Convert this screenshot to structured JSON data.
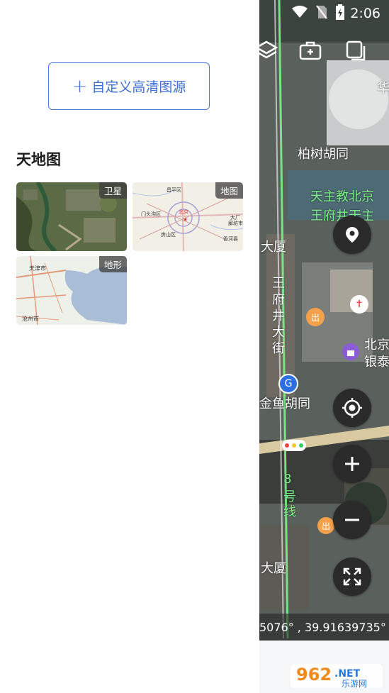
{
  "drawer": {
    "custom_source_button": {
      "icon": "plus-icon",
      "label": "自定义高清图源"
    },
    "section_title": "天地图",
    "tiles": [
      {
        "name": "satellite",
        "badge": "卫星"
      },
      {
        "name": "map",
        "badge": "地图",
        "labels": [
          "昌平区",
          "北京",
          "门头沟区",
          "大厂",
          "房山区",
          "香河县",
          "廊坊市"
        ]
      },
      {
        "name": "terrain",
        "badge": "地形",
        "labels": [
          "天津市",
          "沧州市"
        ]
      }
    ]
  },
  "status_bar": {
    "time": "2:06",
    "icons": [
      "wifi-icon",
      "no-sim-icon",
      "battery-icon"
    ]
  },
  "map": {
    "toolbar_icons": [
      "layers-icon",
      "toolbox-icon",
      "copy-icon"
    ],
    "labels": [
      {
        "text": "柏树胡同",
        "color": "#ffffff"
      },
      {
        "text": "天主教北京",
        "color": "#7ef08b"
      },
      {
        "text": "王府井天主",
        "color": "#7ef08b"
      },
      {
        "text": "大厦",
        "color": "#ffffff"
      },
      {
        "text": "王",
        "color": "#ffffff"
      },
      {
        "text": "府",
        "color": "#ffffff"
      },
      {
        "text": "井",
        "color": "#ffffff"
      },
      {
        "text": "大",
        "color": "#ffffff"
      },
      {
        "text": "街",
        "color": "#ffffff"
      },
      {
        "text": "北京",
        "color": "#ffffff"
      },
      {
        "text": "银泰",
        "color": "#ffffff"
      },
      {
        "text": "金鱼胡同",
        "color": "#ffffff"
      },
      {
        "text": "8",
        "color": "#7ef08b"
      },
      {
        "text": "号",
        "color": "#7ef08b"
      },
      {
        "text": "线",
        "color": "#7ef08b"
      },
      {
        "text": "大厦",
        "color": "#ffffff"
      },
      {
        "text": "华",
        "color": "#ffffff"
      }
    ],
    "fab_buttons": [
      "poi-pin-button",
      "locate-button",
      "zoom-in-button",
      "zoom-out-button",
      "fullscreen-button"
    ],
    "coordinates": "5076° , 39.91639735°"
  },
  "watermark": {
    "text": "962.NET",
    "subtext": "乐游网"
  },
  "colors": {
    "accent": "#3f6fd0",
    "fab": "#2a2a2a"
  }
}
